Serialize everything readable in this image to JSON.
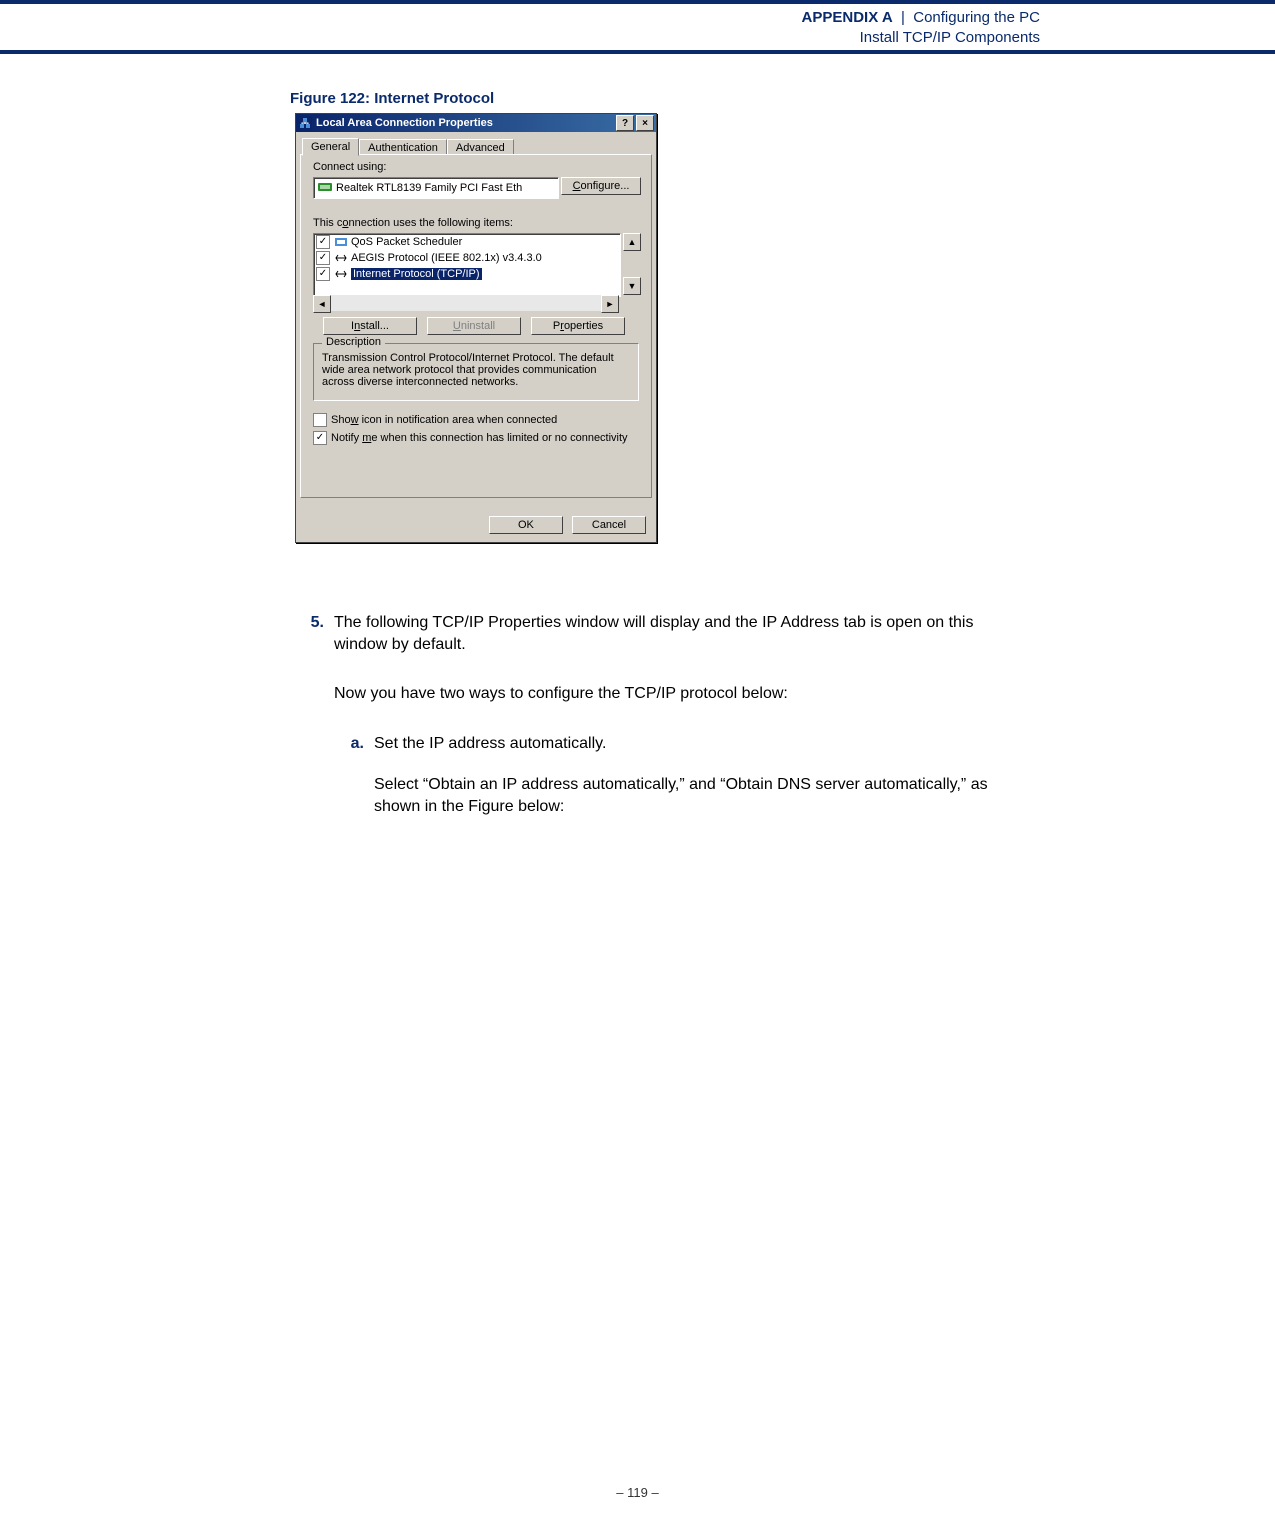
{
  "header": {
    "appendix": "APPENDIX A",
    "chapter": "Configuring the PC",
    "section": "Install TCP/IP Components"
  },
  "figure": {
    "caption": "Figure 122:  Internet Protocol"
  },
  "dialog": {
    "title": "Local Area Connection    Properties",
    "help_btn": "?",
    "close_btn": "×",
    "tabs": [
      "General",
      "Authentication",
      "Advanced"
    ],
    "connect_using_label": "Connect using:",
    "adapter": "Realtek RTL8139 Family PCI Fast Eth",
    "configure_btn": "onfigure...",
    "items_label": "This connection uses the following items:",
    "items": [
      {
        "checked": true,
        "label": "QoS Packet Scheduler"
      },
      {
        "checked": true,
        "label": "AEGIS Protocol (IEEE 802.1x) v3.4.3.0"
      },
      {
        "checked": true,
        "label": "Internet Protocol (TCP/IP)",
        "selected": true
      }
    ],
    "install_btn": "Install...",
    "uninstall_btn": "Uninstall",
    "properties_btn": "Properties",
    "desc_legend": "Description",
    "description": "Transmission Control Protocol/Internet Protocol. The default wide area network protocol that provides communication across diverse interconnected networks.",
    "show_icon_checked": false,
    "show_icon_label": "Show icon in notification area when connected",
    "notify_checked": true,
    "notify_label": "Notify me when this connection has limited or no connectivity",
    "ok_btn": "OK",
    "cancel_btn": "Cancel"
  },
  "body": {
    "step_num": "5.",
    "step_text": "The following TCP/IP Properties window will display and the IP Address tab is open on this window by default.",
    "para2": "Now you have two ways to configure the TCP/IP protocol below:",
    "sub_a_num": "a.",
    "sub_a_text": "Set the IP address automatically.",
    "sub_a_para": "Select “Obtain an IP address automatically,” and “Obtain DNS server automatically,” as shown in the Figure below:"
  },
  "footer": {
    "page": "–  119  –"
  }
}
